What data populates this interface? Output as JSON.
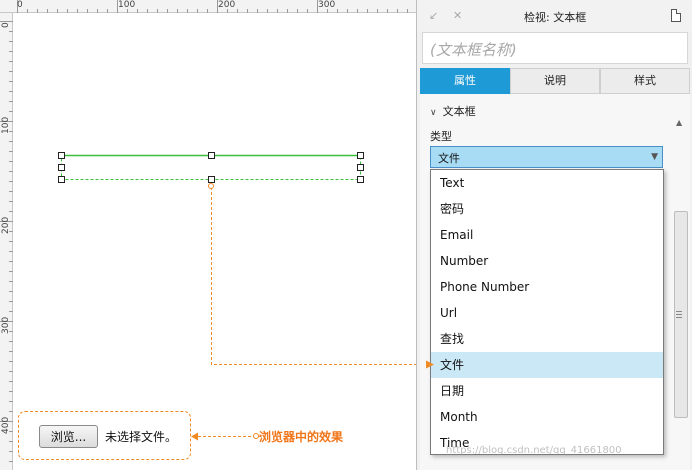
{
  "ruler": {
    "top_labels": [
      "0",
      "100",
      "200",
      "300"
    ],
    "left_labels": [
      "0",
      "100",
      "200",
      "300",
      "400"
    ]
  },
  "demo": {
    "browse_button": "浏览...",
    "no_file_text": "未选择文件。",
    "effect_label": "浏览器中的效果"
  },
  "panel": {
    "title": "检视: 文本框",
    "name_placeholder": "(文本框名称)",
    "icons": {
      "pin": "pin-icon",
      "close": "close-icon",
      "page": "page-icon"
    },
    "tabs": [
      {
        "label": "属性",
        "active": true
      },
      {
        "label": "说明",
        "active": false
      },
      {
        "label": "样式",
        "active": false
      }
    ],
    "section": {
      "title": "文本框",
      "collapse_icon": "chevron-down-icon"
    },
    "type_label": "类型",
    "select": {
      "value": "文件",
      "arrow_icon": "triangle-down-icon"
    },
    "options": [
      "Text",
      "密码",
      "Email",
      "Number",
      "Phone Number",
      "Url",
      "查找",
      "文件",
      "日期",
      "Month",
      "Time"
    ],
    "selected_option": "文件"
  },
  "colors": {
    "accent_blue": "#1e9ad6",
    "select_bg": "#a8dcf4",
    "selected_row": "#cbe8f6",
    "selection_green": "#3cc03c",
    "annotation_orange": "#f08a24"
  },
  "watermark": "https://blog.csdn.net/qq_41661800"
}
